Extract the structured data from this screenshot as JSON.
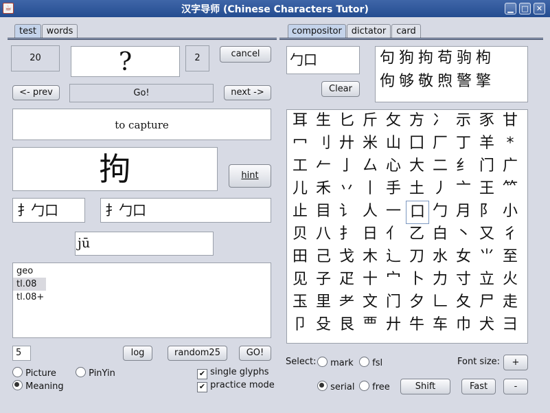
{
  "window": {
    "title": "汉字导师 (Chinese Characters Tutor)",
    "icon": "java-icon",
    "controls": {
      "minimize": "▁",
      "maximize": "□",
      "close": "✕"
    }
  },
  "left": {
    "tabs": [
      "test",
      "words"
    ],
    "count_box": "20",
    "question": "?",
    "score_box": "2",
    "cancel_label": "cancel",
    "prev_label": "<- prev",
    "go_label": "Go!",
    "next_label": "next ->",
    "meaning": "to capture",
    "character": "拘",
    "hint_label": "hint",
    "composition_left": "扌勹口",
    "composition_right": "扌勹口",
    "pinyin": "jū",
    "lists": [
      "geo",
      "tl.08",
      "tl.08+"
    ],
    "quantity": "5",
    "log_label": "log",
    "random_label": "random25",
    "go2_label": "GO!",
    "opt_picture": "Picture",
    "opt_pinyin": "PinYin",
    "opt_meaning": "Meaning",
    "opt_single": "single glyphs",
    "opt_practice": "practice mode"
  },
  "right": {
    "tabs": [
      "compositor",
      "dictator",
      "card"
    ],
    "input": "勹口",
    "clear_label": "Clear",
    "results_row1": "句狗拘苟驹枸",
    "results_row2": "佝够敬煦警擎",
    "radicals": [
      [
        "耳",
        "生",
        "匕",
        "斤",
        "攵",
        "方",
        "冫",
        "示",
        "豕",
        "甘"
      ],
      [
        "冖",
        "刂",
        "廾",
        "米",
        "山",
        "囗",
        "厂",
        "丁",
        "羊",
        "*"
      ],
      [
        "工",
        "𠂉",
        "亅",
        "厶",
        "心",
        "大",
        "二",
        "纟",
        "门",
        "广"
      ],
      [
        "儿",
        "禾",
        "丷",
        "丨",
        "手",
        "土",
        "丿",
        "亠",
        "王",
        "⺮"
      ],
      [
        "止",
        "目",
        "讠",
        "人",
        "一",
        "口",
        "勹",
        "月",
        "阝",
        "小"
      ],
      [
        "贝",
        "八",
        "扌",
        "日",
        "亻",
        "乙",
        "白",
        "丶",
        "又",
        "彳"
      ],
      [
        "田",
        "己",
        "戈",
        "木",
        "辶",
        "刀",
        "水",
        "女",
        "⺌",
        "至"
      ],
      [
        "见",
        "子",
        "疋",
        "十",
        "宀",
        "卜",
        "力",
        "寸",
        "立",
        "火"
      ],
      [
        "玉",
        "里",
        "耂",
        "文",
        "门",
        "夕",
        "𠃊",
        "夂",
        "尸",
        "走"
      ],
      [
        "卩",
        "殳",
        "艮",
        "覀",
        "廾",
        "牛",
        "车",
        "巾",
        "犬",
        "彐"
      ]
    ],
    "select_label": "Select:",
    "mark_label": "mark",
    "fsl_label": "fsl",
    "font_size_label": "Font size:",
    "plus_label": "+",
    "serial_label": "serial",
    "free_label": "free",
    "shift_label": "Shift",
    "fast_label": "Fast",
    "minus_label": "-"
  }
}
